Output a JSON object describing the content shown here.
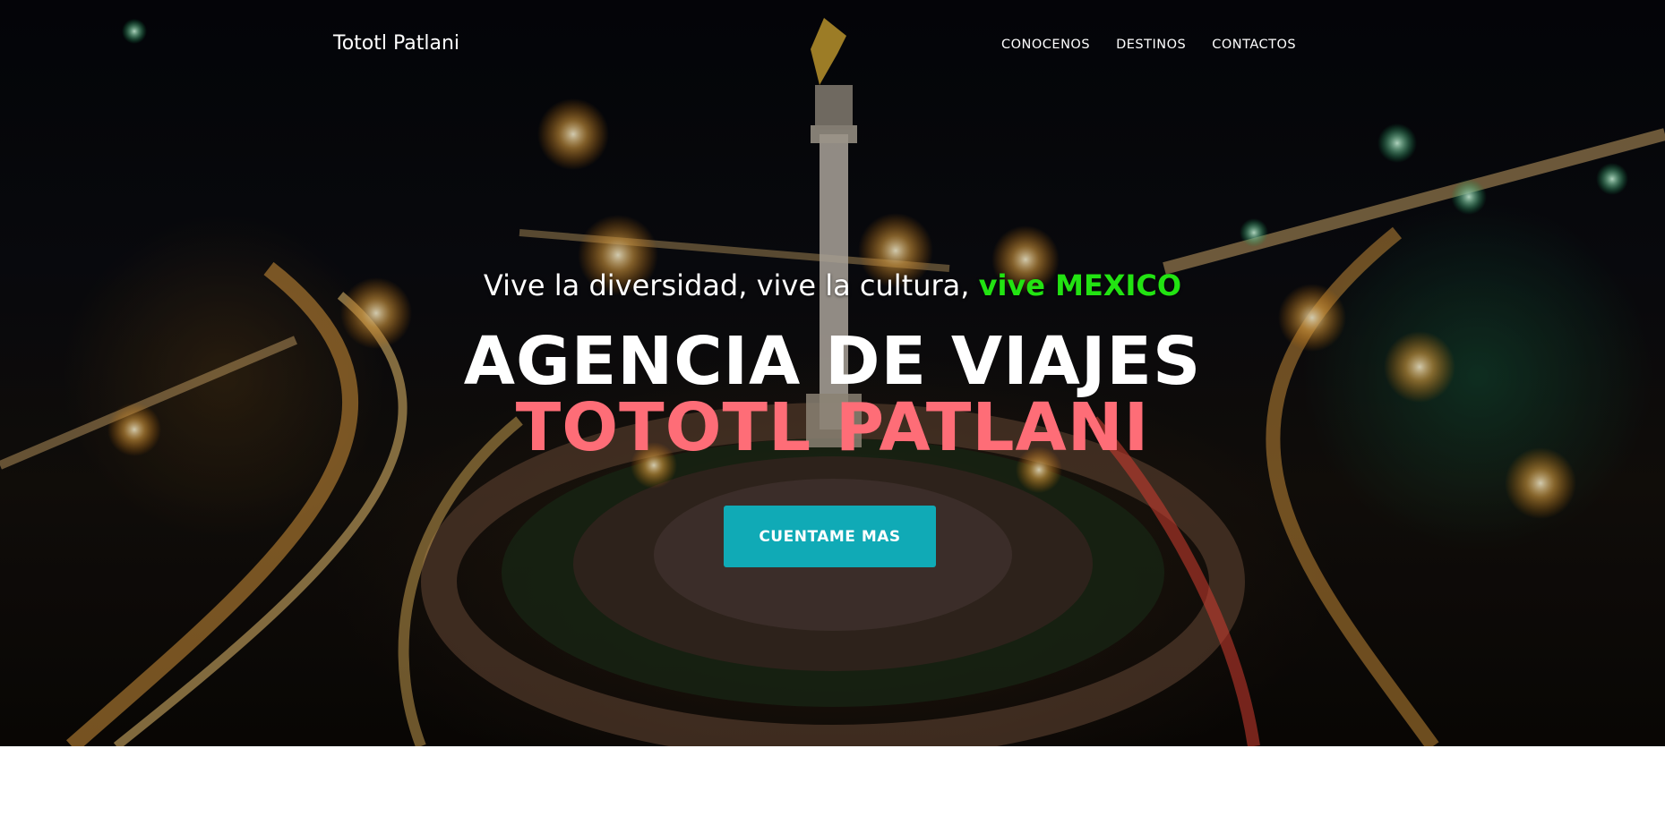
{
  "navbar": {
    "brand": "Tototl Patlani",
    "links": [
      "CONOCENOS",
      "DESTINOS",
      "CONTACTOS"
    ]
  },
  "hero": {
    "subheading_text": "Vive la diversidad, vive la cultura, ",
    "subheading_accent": "vive MEXICO",
    "heading_line1": "AGENCIA DE VIAJES",
    "heading_line2": "TOTOTL PATLANI",
    "cta_label": "CUENTAME MAS",
    "background_image": "night-city-angel-monument-photo"
  },
  "colors": {
    "accent_green": "#22e312",
    "accent_pink": "#fe6d77",
    "cta_teal": "#10aab6"
  }
}
